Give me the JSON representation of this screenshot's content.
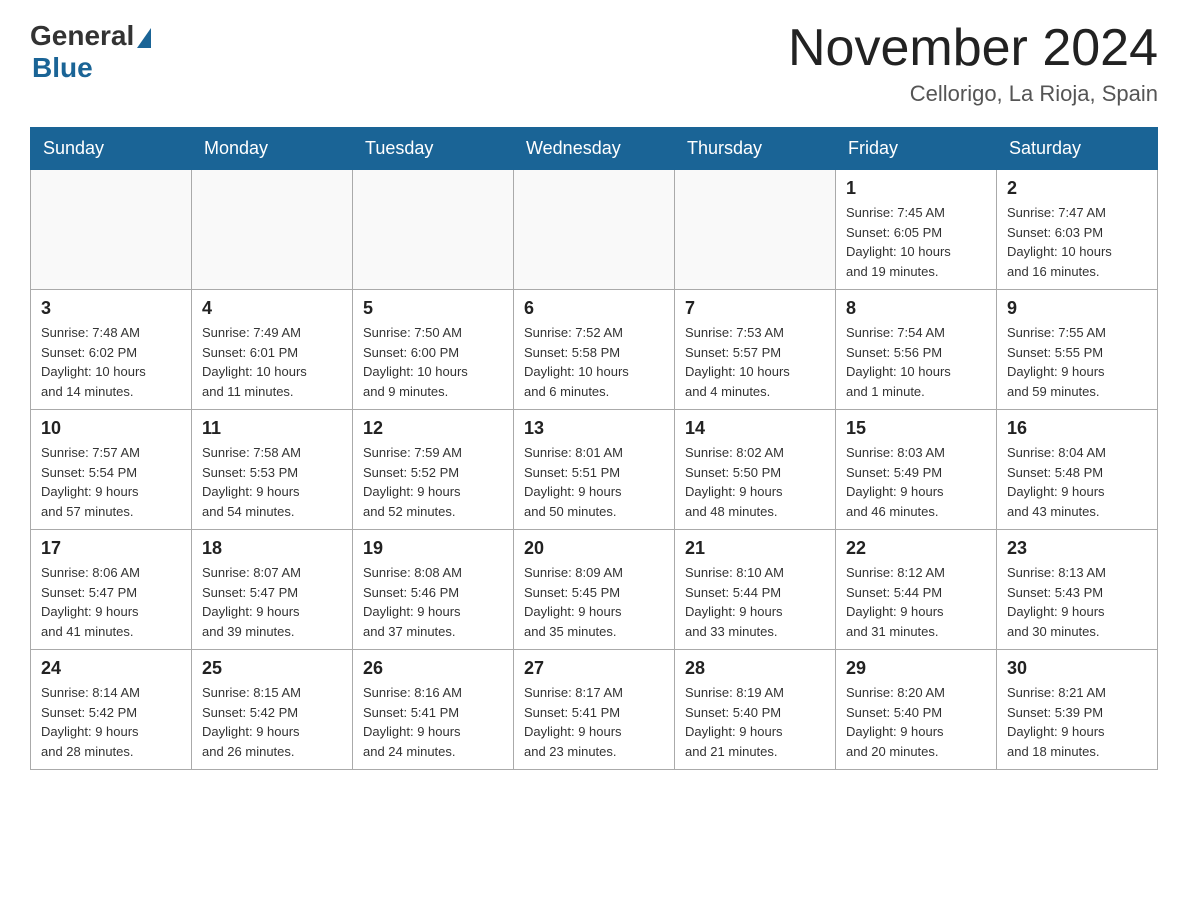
{
  "header": {
    "logo_general": "General",
    "logo_blue": "Blue",
    "month_year": "November 2024",
    "location": "Cellorigo, La Rioja, Spain"
  },
  "weekdays": [
    "Sunday",
    "Monday",
    "Tuesday",
    "Wednesday",
    "Thursday",
    "Friday",
    "Saturday"
  ],
  "weeks": [
    [
      {
        "day": "",
        "info": ""
      },
      {
        "day": "",
        "info": ""
      },
      {
        "day": "",
        "info": ""
      },
      {
        "day": "",
        "info": ""
      },
      {
        "day": "",
        "info": ""
      },
      {
        "day": "1",
        "info": "Sunrise: 7:45 AM\nSunset: 6:05 PM\nDaylight: 10 hours\nand 19 minutes."
      },
      {
        "day": "2",
        "info": "Sunrise: 7:47 AM\nSunset: 6:03 PM\nDaylight: 10 hours\nand 16 minutes."
      }
    ],
    [
      {
        "day": "3",
        "info": "Sunrise: 7:48 AM\nSunset: 6:02 PM\nDaylight: 10 hours\nand 14 minutes."
      },
      {
        "day": "4",
        "info": "Sunrise: 7:49 AM\nSunset: 6:01 PM\nDaylight: 10 hours\nand 11 minutes."
      },
      {
        "day": "5",
        "info": "Sunrise: 7:50 AM\nSunset: 6:00 PM\nDaylight: 10 hours\nand 9 minutes."
      },
      {
        "day": "6",
        "info": "Sunrise: 7:52 AM\nSunset: 5:58 PM\nDaylight: 10 hours\nand 6 minutes."
      },
      {
        "day": "7",
        "info": "Sunrise: 7:53 AM\nSunset: 5:57 PM\nDaylight: 10 hours\nand 4 minutes."
      },
      {
        "day": "8",
        "info": "Sunrise: 7:54 AM\nSunset: 5:56 PM\nDaylight: 10 hours\nand 1 minute."
      },
      {
        "day": "9",
        "info": "Sunrise: 7:55 AM\nSunset: 5:55 PM\nDaylight: 9 hours\nand 59 minutes."
      }
    ],
    [
      {
        "day": "10",
        "info": "Sunrise: 7:57 AM\nSunset: 5:54 PM\nDaylight: 9 hours\nand 57 minutes."
      },
      {
        "day": "11",
        "info": "Sunrise: 7:58 AM\nSunset: 5:53 PM\nDaylight: 9 hours\nand 54 minutes."
      },
      {
        "day": "12",
        "info": "Sunrise: 7:59 AM\nSunset: 5:52 PM\nDaylight: 9 hours\nand 52 minutes."
      },
      {
        "day": "13",
        "info": "Sunrise: 8:01 AM\nSunset: 5:51 PM\nDaylight: 9 hours\nand 50 minutes."
      },
      {
        "day": "14",
        "info": "Sunrise: 8:02 AM\nSunset: 5:50 PM\nDaylight: 9 hours\nand 48 minutes."
      },
      {
        "day": "15",
        "info": "Sunrise: 8:03 AM\nSunset: 5:49 PM\nDaylight: 9 hours\nand 46 minutes."
      },
      {
        "day": "16",
        "info": "Sunrise: 8:04 AM\nSunset: 5:48 PM\nDaylight: 9 hours\nand 43 minutes."
      }
    ],
    [
      {
        "day": "17",
        "info": "Sunrise: 8:06 AM\nSunset: 5:47 PM\nDaylight: 9 hours\nand 41 minutes."
      },
      {
        "day": "18",
        "info": "Sunrise: 8:07 AM\nSunset: 5:47 PM\nDaylight: 9 hours\nand 39 minutes."
      },
      {
        "day": "19",
        "info": "Sunrise: 8:08 AM\nSunset: 5:46 PM\nDaylight: 9 hours\nand 37 minutes."
      },
      {
        "day": "20",
        "info": "Sunrise: 8:09 AM\nSunset: 5:45 PM\nDaylight: 9 hours\nand 35 minutes."
      },
      {
        "day": "21",
        "info": "Sunrise: 8:10 AM\nSunset: 5:44 PM\nDaylight: 9 hours\nand 33 minutes."
      },
      {
        "day": "22",
        "info": "Sunrise: 8:12 AM\nSunset: 5:44 PM\nDaylight: 9 hours\nand 31 minutes."
      },
      {
        "day": "23",
        "info": "Sunrise: 8:13 AM\nSunset: 5:43 PM\nDaylight: 9 hours\nand 30 minutes."
      }
    ],
    [
      {
        "day": "24",
        "info": "Sunrise: 8:14 AM\nSunset: 5:42 PM\nDaylight: 9 hours\nand 28 minutes."
      },
      {
        "day": "25",
        "info": "Sunrise: 8:15 AM\nSunset: 5:42 PM\nDaylight: 9 hours\nand 26 minutes."
      },
      {
        "day": "26",
        "info": "Sunrise: 8:16 AM\nSunset: 5:41 PM\nDaylight: 9 hours\nand 24 minutes."
      },
      {
        "day": "27",
        "info": "Sunrise: 8:17 AM\nSunset: 5:41 PM\nDaylight: 9 hours\nand 23 minutes."
      },
      {
        "day": "28",
        "info": "Sunrise: 8:19 AM\nSunset: 5:40 PM\nDaylight: 9 hours\nand 21 minutes."
      },
      {
        "day": "29",
        "info": "Sunrise: 8:20 AM\nSunset: 5:40 PM\nDaylight: 9 hours\nand 20 minutes."
      },
      {
        "day": "30",
        "info": "Sunrise: 8:21 AM\nSunset: 5:39 PM\nDaylight: 9 hours\nand 18 minutes."
      }
    ]
  ]
}
